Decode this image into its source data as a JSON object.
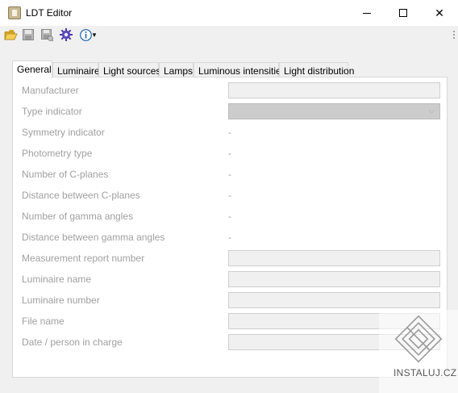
{
  "window": {
    "title": "LDT Editor",
    "minimize_glyph": "",
    "close_glyph": "✕"
  },
  "toolbar": {
    "icons": [
      "open-folder-icon",
      "save-icon",
      "save-as-icon",
      "settings-gear-icon",
      "info-icon"
    ],
    "info_dropdown_glyph": "▾"
  },
  "tabs": [
    {
      "label": "General",
      "active": true
    },
    {
      "label": "Luminaire",
      "active": false
    },
    {
      "label": "Light sources",
      "active": false
    },
    {
      "label": "Lamps",
      "active": false
    },
    {
      "label": "Luminous intensities",
      "active": false
    },
    {
      "label": "Light distribution",
      "active": false
    }
  ],
  "general": {
    "manufacturer": {
      "label": "Manufacturer",
      "value": ""
    },
    "type_indicator": {
      "label": "Type indicator",
      "value": "",
      "chevron": "⌵"
    },
    "symmetry_indicator": {
      "label": "Symmetry indicator",
      "value": "-"
    },
    "photometry_type": {
      "label": "Photometry type",
      "value": "-"
    },
    "number_c_planes": {
      "label": "Number of C-planes",
      "value": "-"
    },
    "distance_c_planes": {
      "label": "Distance between C-planes",
      "value": "-"
    },
    "number_gamma_angles": {
      "label": "Number of gamma angles",
      "value": "-"
    },
    "distance_gamma_angles": {
      "label": "Distance between gamma angles",
      "value": "-"
    },
    "measurement_report_number": {
      "label": "Measurement report number",
      "value": ""
    },
    "luminaire_name": {
      "label": "Luminaire name",
      "value": ""
    },
    "luminaire_number": {
      "label": "Luminaire number",
      "value": ""
    },
    "file_name": {
      "label": "File name",
      "value": ""
    },
    "date_person": {
      "label": "Date / person in charge",
      "value": ""
    }
  },
  "watermark": {
    "text": "INSTALUJ.CZ"
  },
  "colors": {
    "disabled_text": "#a0a0a0",
    "field_bg": "#f0f0f0",
    "select_bg": "#cccccc",
    "gear": "#4a3aa8",
    "info": "#1a5fb4",
    "folder": "#e8b830"
  }
}
